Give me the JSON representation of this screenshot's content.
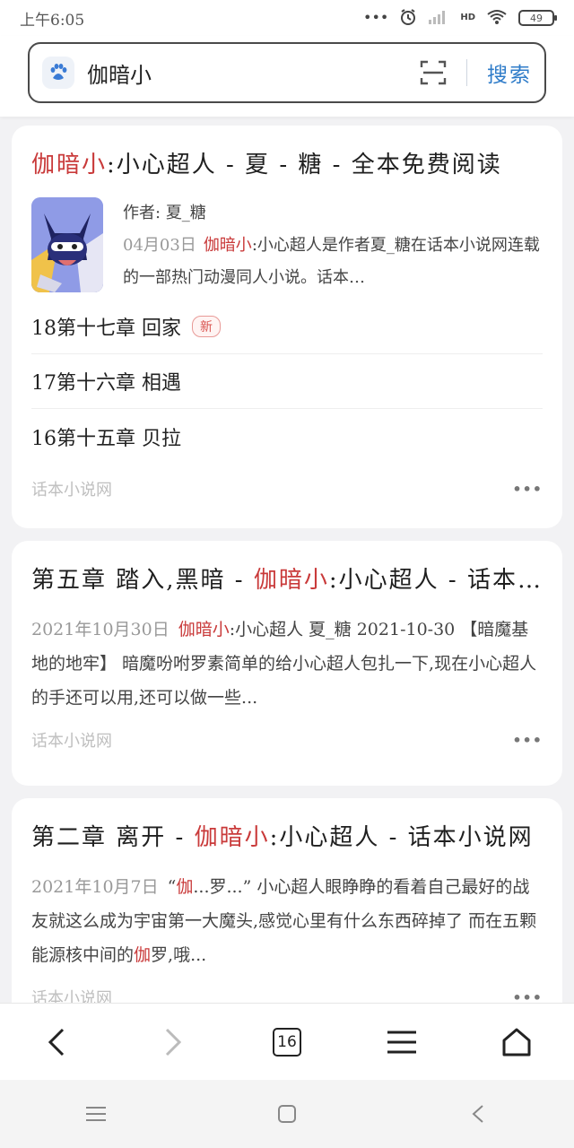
{
  "status_bar": {
    "time": "上午6:05",
    "battery": "49",
    "hd_label": "HD"
  },
  "search": {
    "query": "伽暗小",
    "button_label": "搜索"
  },
  "results": {
    "card1": {
      "title_highlight": "伽暗小",
      "title_rest": ":小心超人 - 夏 - 糖 - 全本免费阅读",
      "author_label": "作者:",
      "author": "夏_糖",
      "date": "04月03日",
      "desc_highlight": "伽暗小",
      "desc_rest": ":小心超人是作者夏_糖在话本小说网连载的一部热门动漫同人小说。话本…",
      "chapters": [
        {
          "label": "18第十七章 回家",
          "badge": "新"
        },
        {
          "label": "17第十六章 相遇",
          "badge": ""
        },
        {
          "label": "16第十五章 贝拉",
          "badge": ""
        }
      ],
      "source": "话本小说网"
    },
    "card2": {
      "title_pre": "第五章 踏入,黑暗 - ",
      "title_highlight": "伽暗小",
      "title_post": ":小心超人 - 话本小说网",
      "date": "2021年10月30日",
      "snippet_highlight": "伽暗小",
      "snippet_rest": ":小心超人 夏_糖 2021-10-30 【暗魔基地的地牢】 暗魔吩咐罗素简单的给小心超人包扎一下,现在小心超人的手还可以用,还可以做一些...",
      "source": "话本小说网"
    },
    "card3": {
      "title_pre": "第二章 离开 - ",
      "title_highlight": "伽暗小",
      "title_post": ":小心超人 - 话本小说网",
      "date": "2021年10月7日",
      "snippet_a": "“",
      "snippet_hl1": "伽",
      "snippet_b": "...罗...” 小心超人眼睁睁的看着自己最好的战友就这么成为宇宙第一大魔头,感觉心里有什么东西碎掉了 而在五颗能源核中间的",
      "snippet_hl2": "伽",
      "snippet_c": "罗,哦...",
      "source": "话本小说网"
    }
  },
  "browser_bar": {
    "tab_count": "16"
  },
  "colors": {
    "highlight": "#c93a3a",
    "accent": "#2f7cc9"
  },
  "icons": [
    "back-icon",
    "forward-icon",
    "tabs-icon",
    "menu-icon",
    "home-icon",
    "paw-icon",
    "scan-icon",
    "alarm-icon",
    "signal-icon",
    "wifi-icon",
    "battery-icon",
    "more-icon"
  ]
}
